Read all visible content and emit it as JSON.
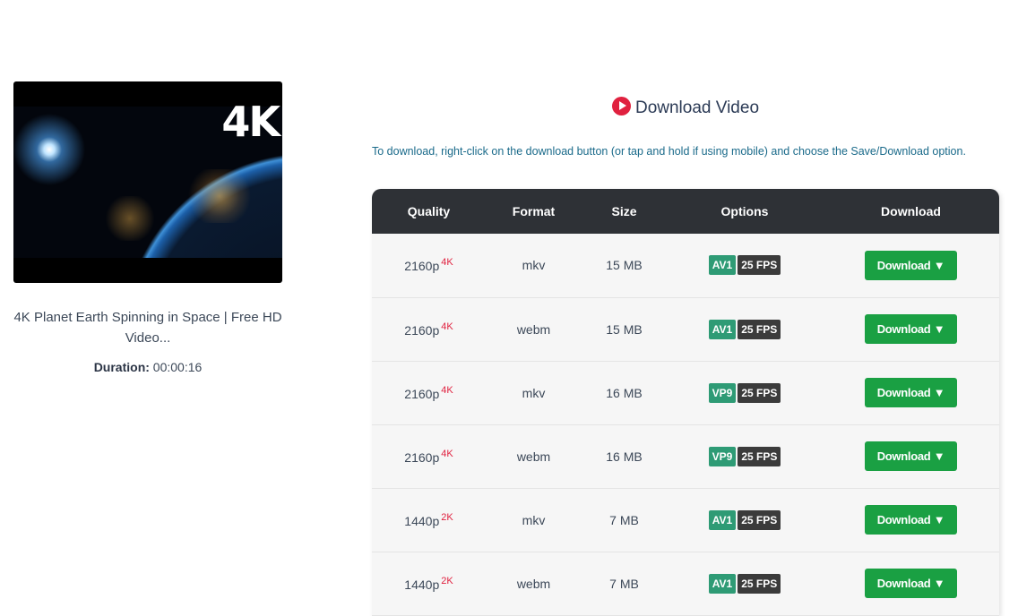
{
  "video": {
    "thumbnail_overlay_text": "4K",
    "title": "4K Planet Earth Spinning in Space | Free HD Video...",
    "duration_label": "Duration:",
    "duration_value": "00:00:16"
  },
  "download_section": {
    "heading": "Download Video",
    "heading_icon": "play-circle-icon",
    "hint": "To download, right-click on the download button (or tap and hold if using mobile) and choose the Save/Download option.",
    "columns": [
      "Quality",
      "Format",
      "Size",
      "Options",
      "Download"
    ],
    "rows": [
      {
        "quality": "2160p",
        "badge": "4K",
        "format": "mkv",
        "size": "15 MB",
        "codec": "AV1",
        "fps": "25 FPS",
        "button": "Download ▼"
      },
      {
        "quality": "2160p",
        "badge": "4K",
        "format": "webm",
        "size": "15 MB",
        "codec": "AV1",
        "fps": "25 FPS",
        "button": "Download ▼"
      },
      {
        "quality": "2160p",
        "badge": "4K",
        "format": "mkv",
        "size": "16 MB",
        "codec": "VP9",
        "fps": "25 FPS",
        "button": "Download ▼"
      },
      {
        "quality": "2160p",
        "badge": "4K",
        "format": "webm",
        "size": "16 MB",
        "codec": "VP9",
        "fps": "25 FPS",
        "button": "Download ▼"
      },
      {
        "quality": "1440p",
        "badge": "2K",
        "format": "mkv",
        "size": "7 MB",
        "codec": "AV1",
        "fps": "25 FPS",
        "button": "Download ▼"
      },
      {
        "quality": "1440p",
        "badge": "2K",
        "format": "webm",
        "size": "7 MB",
        "codec": "AV1",
        "fps": "25 FPS",
        "button": "Download ▼"
      }
    ]
  },
  "colors": {
    "header_bg": "#2e3136",
    "download_button": "#1aa043",
    "codec_tag": "#2e9b75",
    "fps_tag": "#3b3b3b",
    "resolution_badge": "#e0213f",
    "heading_icon": "#e0213f"
  }
}
